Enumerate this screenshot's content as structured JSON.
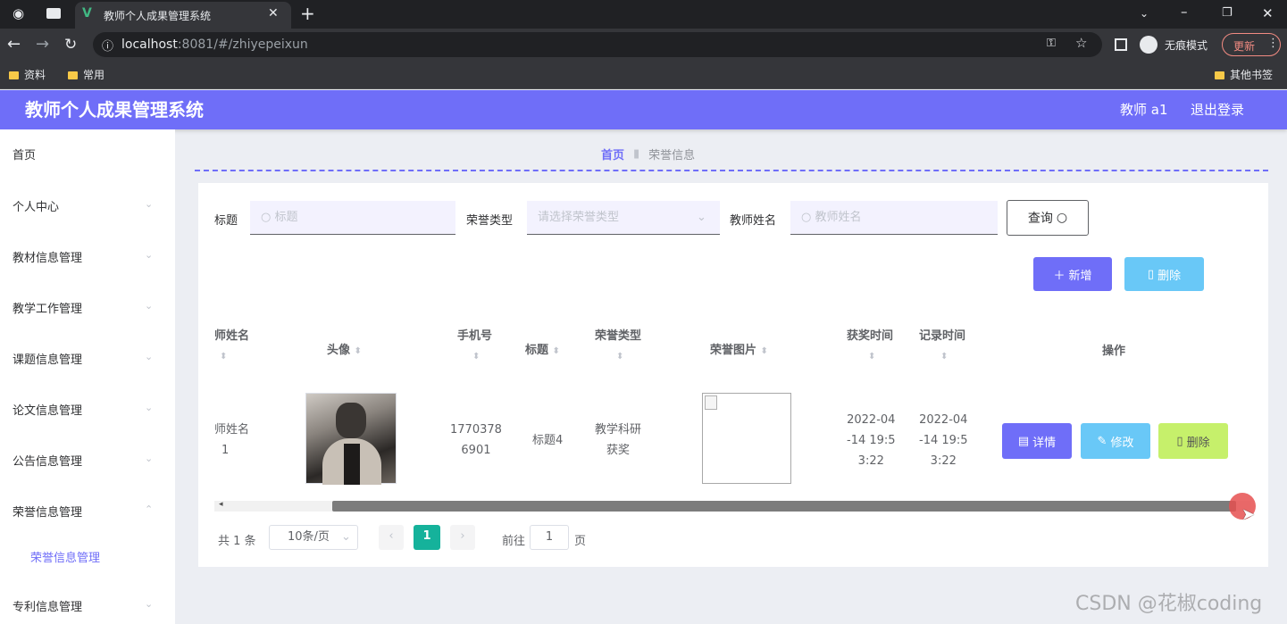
{
  "browser": {
    "tab_title": "教师个人成果管理系统",
    "url_host": "localhost",
    "url_rest": ":8081/#/zhiyepeixun",
    "incognito_label": "无痕模式",
    "update_label": "更新",
    "bookmarks": [
      "资料",
      "常用"
    ],
    "other_bookmarks": "其他书签"
  },
  "app": {
    "title": "教师个人成果管理系统",
    "user": "教师 a1",
    "logout": "退出登录",
    "accent": "#6f6ef8"
  },
  "sidebar": {
    "items": [
      "首页",
      "个人中心",
      "教材信息管理",
      "教学工作管理",
      "课题信息管理",
      "论文信息管理",
      "公告信息管理",
      "荣誉信息管理",
      "专利信息管理"
    ],
    "sub_item": "荣誉信息管理"
  },
  "breadcrumb": {
    "home": "首页",
    "current": "荣誉信息"
  },
  "search": {
    "title_label": "标题",
    "title_placeholder": "标题",
    "type_label": "荣誉类型",
    "type_placeholder": "请选择荣誉类型",
    "teacher_label": "教师姓名",
    "teacher_placeholder": "教师姓名",
    "query_button": "查询"
  },
  "toolbar": {
    "add": "新增",
    "delete": "删除"
  },
  "table": {
    "headers": {
      "teacher_name": "师姓名",
      "avatar": "头像",
      "phone": "手机号",
      "title": "标题",
      "honor_type": "荣誉类型",
      "honor_image": "荣誉图片",
      "award_time": "获奖时间",
      "record_time": "记录时间",
      "actions": "操作"
    },
    "row": {
      "teacher_name_1": "师姓名",
      "teacher_name_2": "1",
      "phone_1": "1770378",
      "phone_2": "6901",
      "title": "标题4",
      "honor_type_1": "教学科研",
      "honor_type_2": "获奖",
      "award_1": "2022-04",
      "award_2": "-14 19:5",
      "award_3": "3:22",
      "record_1": "2022-04",
      "record_2": "-14 19:5",
      "record_3": "3:22"
    },
    "actions": {
      "detail": "详情",
      "edit": "修改",
      "delete": "删除"
    }
  },
  "pagination": {
    "total": "共 1 条",
    "page_size": "10条/页",
    "current_page": "1",
    "goto_label": "前往",
    "goto_value": "1",
    "page_unit": "页"
  },
  "watermark": "CSDN @花椒coding"
}
